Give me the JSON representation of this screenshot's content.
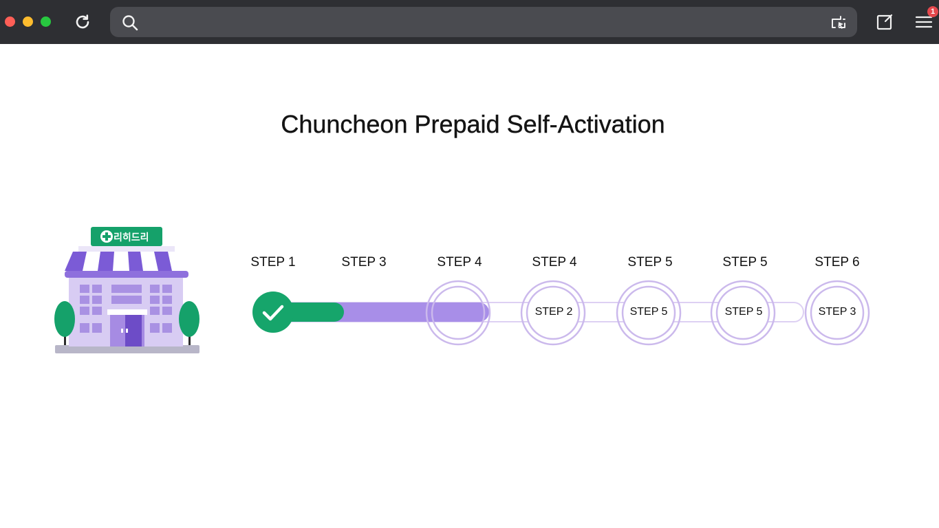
{
  "browser": {
    "address_value": "",
    "notification_count": "1",
    "icons": {
      "reload": "reload-icon",
      "search": "search-icon",
      "extension": "screenshot-extension-icon",
      "compose": "compose-icon",
      "menu": "menu-icon"
    }
  },
  "page": {
    "title": "Chuncheon Prepaid Self-Activation",
    "store_sign": "리히드리"
  },
  "steps": {
    "labels": [
      "STEP 1",
      "STEP 3",
      "STEP 4",
      "STEP 4",
      "STEP 5",
      "STEP 5",
      "STEP 6"
    ],
    "ring_labels": [
      "STEP 2",
      "STEP 5",
      "STEP 5",
      "STEP 3"
    ],
    "completed_step": 1,
    "progress_fraction": 0.42
  },
  "colors": {
    "accent_green": "#16a56b",
    "accent_purple": "#a88ee8",
    "ring_purple": "#cbb9ec",
    "chrome_bg": "#2e2f33"
  }
}
